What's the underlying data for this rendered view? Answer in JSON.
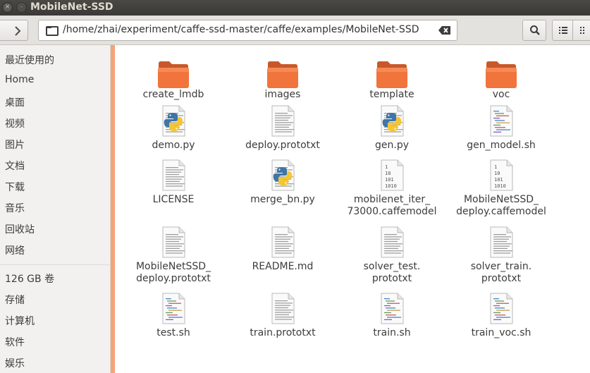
{
  "window": {
    "title": "MobileNet-SSD",
    "close_glyph": "×",
    "min_glyph": "–",
    "max_glyph": "□"
  },
  "toolbar": {
    "path": "/home/zhai/experiment/caffe-ssd-master/caffe/examples/MobileNet-SSD"
  },
  "sidebar": {
    "items": [
      "最近使用的",
      "Home",
      "桌面",
      "视频",
      "图片",
      "文档",
      "下载",
      "音乐",
      "回收站",
      "网络"
    ],
    "devices": [
      "126 GB 卷",
      "存储",
      "计算机",
      "软件",
      "娱乐"
    ]
  },
  "files": [
    {
      "name": "create_lmdb",
      "type": "folder"
    },
    {
      "name": "images",
      "type": "folder"
    },
    {
      "name": "template",
      "type": "folder"
    },
    {
      "name": "voc",
      "type": "folder"
    },
    {
      "name": "demo.py",
      "type": "python"
    },
    {
      "name": "deploy.prototxt",
      "type": "text"
    },
    {
      "name": "gen.py",
      "type": "python"
    },
    {
      "name": "gen_model.sh",
      "type": "script"
    },
    {
      "name": "LICENSE",
      "type": "text"
    },
    {
      "name": "merge_bn.py",
      "type": "python"
    },
    {
      "name": "mobilenet_iter_\n73000.caffemodel",
      "type": "binary"
    },
    {
      "name": "MobileNetSSD_\ndeploy.caffemodel",
      "type": "binary"
    },
    {
      "name": "MobileNetSSD_\ndeploy.prototxt",
      "type": "text"
    },
    {
      "name": "README.md",
      "type": "text"
    },
    {
      "name": "solver_test.\nprototxt",
      "type": "text"
    },
    {
      "name": "solver_train.\nprototxt",
      "type": "text"
    },
    {
      "name": "test.sh",
      "type": "script"
    },
    {
      "name": "train.prototxt",
      "type": "text"
    },
    {
      "name": "train.sh",
      "type": "script"
    },
    {
      "name": "train_voc.sh",
      "type": "script"
    }
  ],
  "binary_icon_lines": [
    "1",
    "10",
    "101",
    "1010"
  ],
  "colors": {
    "folder": "#f0743c",
    "accent_edge": "#f5a37b",
    "titlebar": "#3c3b37"
  }
}
